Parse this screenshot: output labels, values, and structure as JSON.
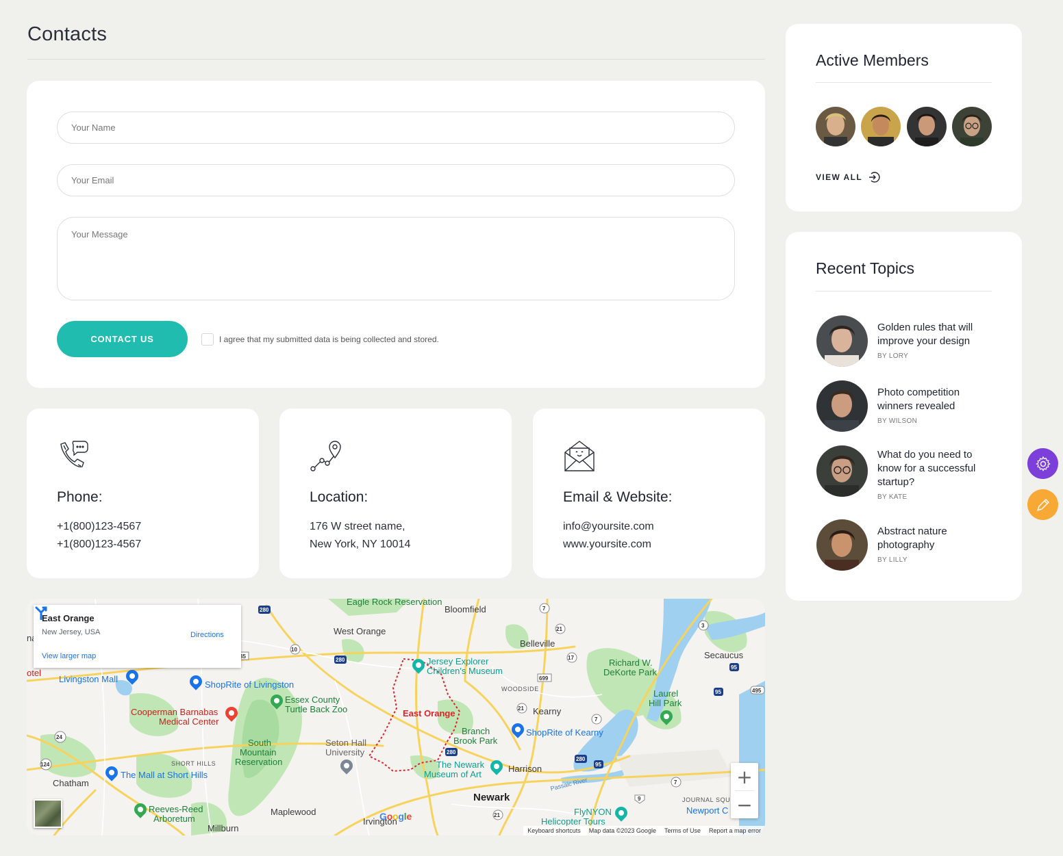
{
  "page": {
    "title": "Contacts"
  },
  "form": {
    "name_placeholder": "Your Name",
    "email_placeholder": "Your Email",
    "message_placeholder": "Your Message",
    "submit_label": "CONTACT US",
    "agree_text": "I agree that my submitted data is being collected and stored.",
    "accent": "#1fbcaf"
  },
  "info": [
    {
      "title": "Phone:",
      "lines": [
        "+1(800)123-4567",
        "+1(800)123-4567"
      ],
      "icon": "phone-icon"
    },
    {
      "title": "Location:",
      "lines": [
        "176 W street name,",
        "New York, NY 10014"
      ],
      "icon": "route-pin-icon"
    },
    {
      "title": "Email & Website:",
      "lines": [
        "info@yoursite.com",
        "www.yoursite.com"
      ],
      "icon": "envelope-icon"
    }
  ],
  "map": {
    "popup": {
      "title": "East Orange",
      "subtitle": "New Jersey, USA",
      "link": "View larger map",
      "directions": "Directions"
    },
    "labels": {
      "eagle_rock": "Eagle Rock Reservation",
      "bloomfield": "Bloomfield",
      "west_orange": "West Orange",
      "belleville": "Belleville",
      "jersey_explorer": "Jersey Explorer",
      "childrens_museum": "Children's Museum",
      "livingston_mall": "Livingston Mall",
      "shoprite_livingston": "ShopRite of Livingston",
      "woodside": "WOODSIDE",
      "essex_zoo_1": "Essex County",
      "essex_zoo_2": "Turtle Back Zoo",
      "cooperman_1": "Cooperman Barnabas",
      "cooperman_2": "Medical Center",
      "east_orange": "East Orange",
      "kearny": "Kearny",
      "richard_1": "Richard W.",
      "richard_2": "DeKorte Park",
      "secaucus": "Secaucus",
      "laurel_1": "Laurel",
      "laurel_2": "Hill Park",
      "south_mountain_1": "South",
      "south_mountain_2": "Mountain",
      "south_mountain_3": "Reservation",
      "seton_1": "Seton Hall",
      "seton_2": "University",
      "branch_1": "Branch",
      "branch_2": "Brook Park",
      "shoprite_kearny": "ShopRite of Kearny",
      "short_hills": "SHORT HILLS",
      "mall_short_hills": "The Mall at Short Hills",
      "newark_museum_1": "The Newark",
      "newark_museum_2": "Museum of Art",
      "harrison": "Harrison",
      "chatham": "Chatham",
      "newark": "Newark",
      "passaic_river": "Passaic River",
      "journal_square": "JOURNAL SQU",
      "newport": "Newport C",
      "reeves_1": "Reeves-Reed",
      "reeves_2": "Arboretum",
      "maplewood": "Maplewood",
      "irvington": "Irvington",
      "flynyon_1": "FlyNYON",
      "flynyon_2": "Helicopter Tours",
      "millburn": "Millburn",
      "hotel": "otel",
      "na": "na"
    },
    "attribution": [
      "Keyboard shortcuts",
      "Map data ©2023 Google",
      "Terms of Use",
      "Report a map error"
    ],
    "google": "Google"
  },
  "members": {
    "title": "Active Members",
    "view_all": "VIEW ALL"
  },
  "topics": {
    "title": "Recent Topics",
    "items": [
      {
        "title": "Golden rules that will improve your design",
        "by": "BY LORY"
      },
      {
        "title": "Photo competition winners revealed",
        "by": "BY WILSON"
      },
      {
        "title": "What do you need to know for a successful startup?",
        "by": "BY KATE"
      },
      {
        "title": "Abstract nature photography",
        "by": "BY LILLY"
      }
    ]
  }
}
